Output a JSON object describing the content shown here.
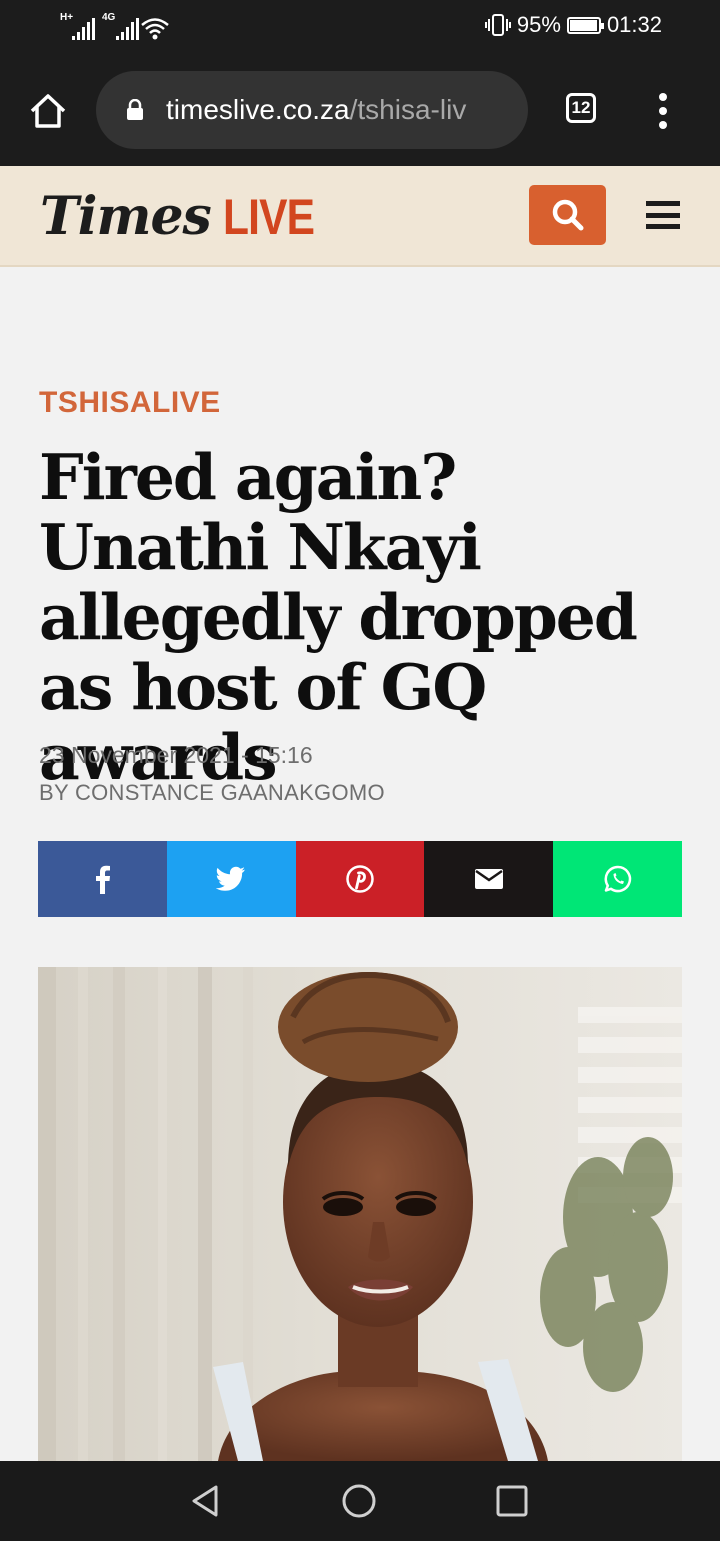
{
  "status_bar": {
    "sim1_label": "H+",
    "sim2_label": "4G",
    "battery": "95%",
    "time": "01:32",
    "battery_level": 0.95
  },
  "browser": {
    "url_domain": "timeslive.co.za",
    "url_path": "/tshisa-liv",
    "tab_count": "12"
  },
  "site": {
    "logo_times": "Times",
    "logo_live": "LIVE",
    "accent": "#d8602f"
  },
  "article": {
    "section": "TSHISALIVE",
    "headline": "Fired again? Unathi Nkayi allegedly dropped as host of GQ awards",
    "date": "23 November 2021 - 15:16",
    "byline": "BY CONSTANCE GAANAKGOMO"
  },
  "share_buttons": [
    {
      "icon": "facebook-icon",
      "color": "#3b5998"
    },
    {
      "icon": "twitter-icon",
      "color": "#1da1f2"
    },
    {
      "icon": "pinterest-icon",
      "color": "#cb2027"
    },
    {
      "icon": "email-icon",
      "color": "#1a1616"
    },
    {
      "icon": "whatsapp-icon",
      "color": "#00e676"
    }
  ]
}
